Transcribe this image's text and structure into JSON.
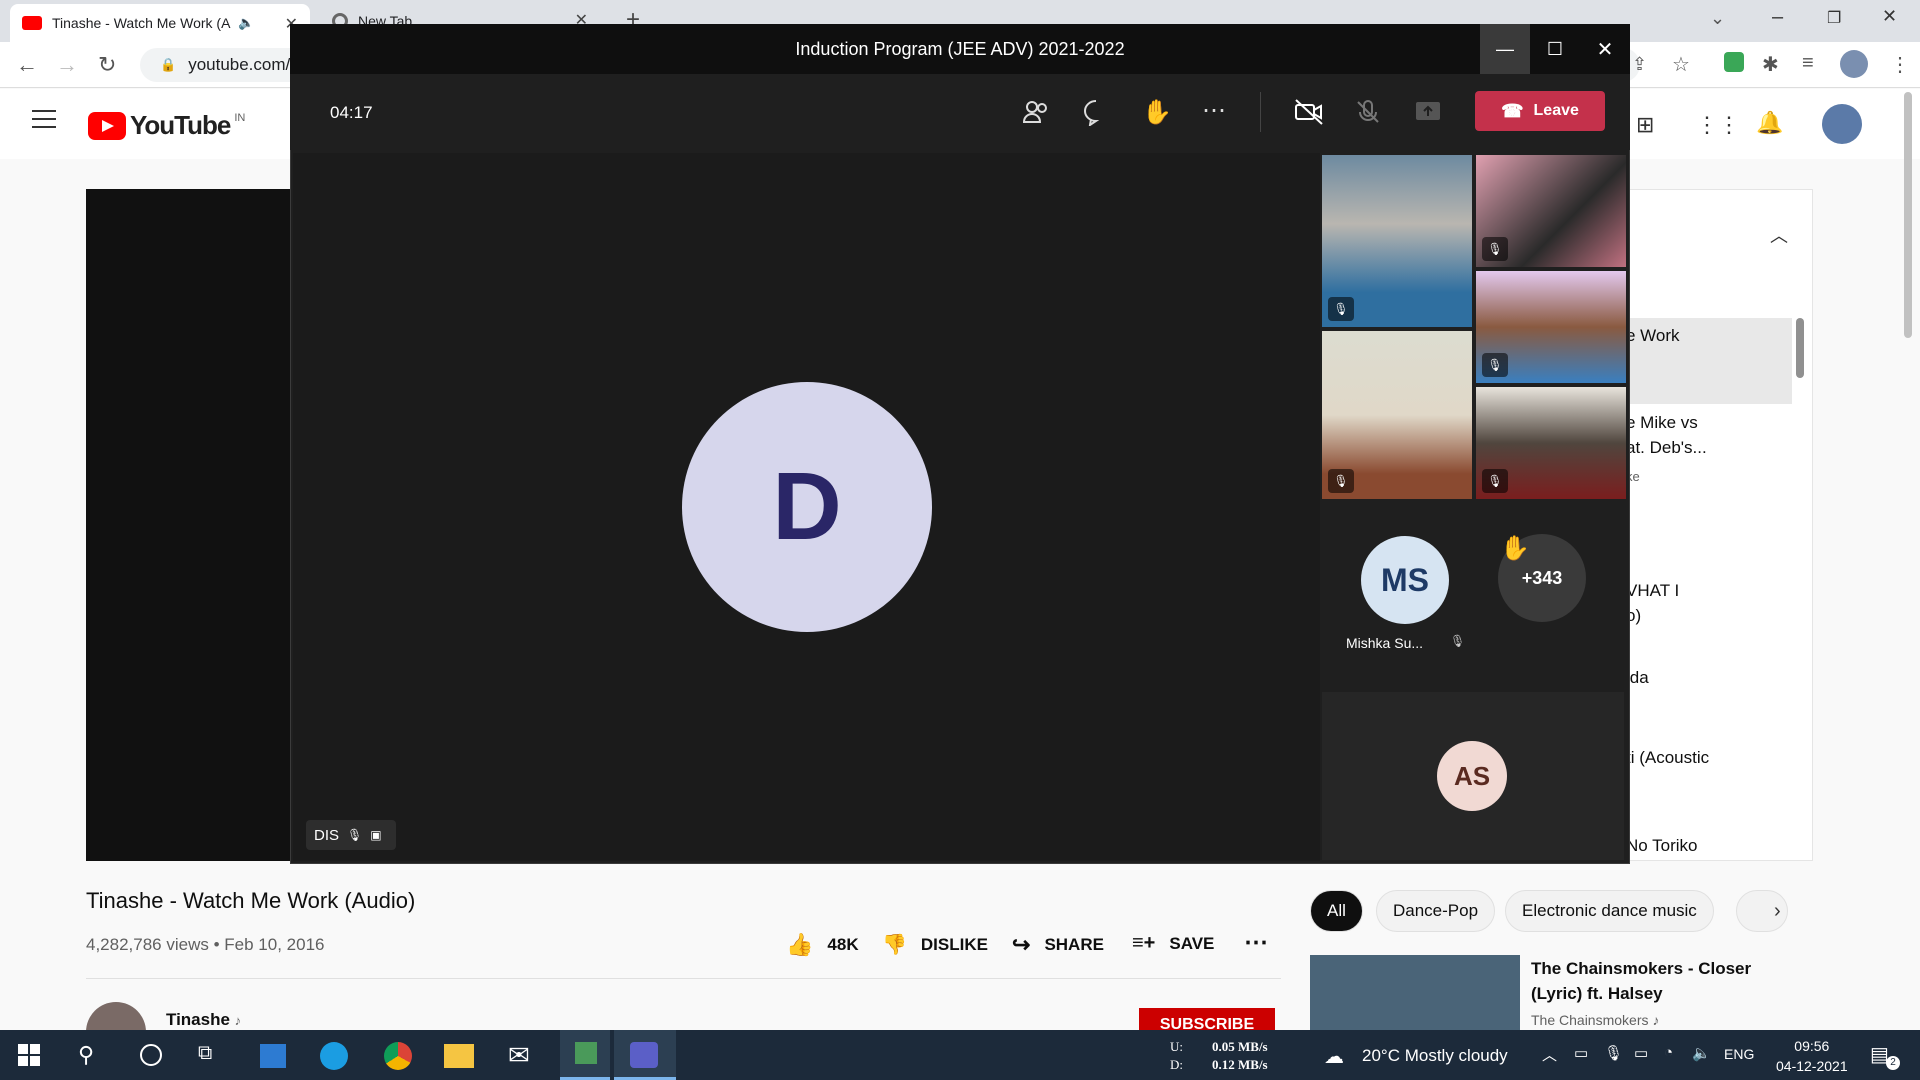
{
  "browser": {
    "tabs": [
      {
        "title": "Tinashe - Watch Me Work (A",
        "active": true
      },
      {
        "title": "New Tab",
        "active": false
      }
    ],
    "new_tab": "+",
    "url": "youtube.com/"
  },
  "youtube": {
    "logo_text": "YouTube",
    "region": "IN",
    "video_title": "Tinashe - Watch Me Work (Audio)",
    "views": "4,282,786 views",
    "date": "• Feb 10, 2016",
    "likes": "48K",
    "dislike": "DISLIKE",
    "share": "SHARE",
    "save": "SAVE",
    "channel": "Tinashe",
    "subscribe": "SUBSCRIBE",
    "sidebar_snippets": [
      "e Work",
      "e Mike vs",
      "at. Deb's...",
      "ke",
      "VHAT I",
      "o)",
      "ida",
      "ti (Acoustic",
      "No Toriko"
    ],
    "chips": [
      "All",
      "Dance-Pop",
      "Electronic dance music"
    ],
    "rec": {
      "title": "The Chainsmokers - Closer (Lyric) ft. Halsey",
      "channel": "The Chainsmokers"
    }
  },
  "teams": {
    "title": "Induction Program (JEE ADV) 2021-2022",
    "timer": "04:17",
    "leave": "Leave",
    "main_avatar": "D",
    "presenter_label": "DIS",
    "ms_initials": "MS",
    "ms_name": "Mishka Su...",
    "overflow_count": "+343",
    "as_initials": "AS"
  },
  "taskbar": {
    "net_up_label": "U:",
    "net_up": "0.05 MB/s",
    "net_down_label": "D:",
    "net_down": "0.12 MB/s",
    "weather": "20°C  Mostly cloudy",
    "lang": "ENG",
    "time": "09:56",
    "date": "04-12-2021",
    "notifications": "2"
  },
  "colors": {
    "youtube_red": "#ff0000",
    "leave_red": "#c4314b",
    "avatar_d_bg": "#d6d6ec",
    "taskbar": "#1c2a3a"
  }
}
